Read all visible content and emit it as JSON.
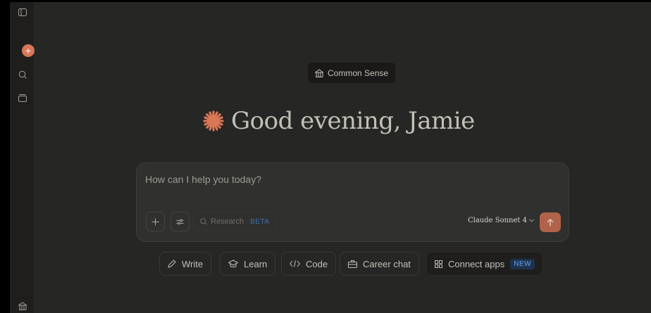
{
  "project": {
    "name": "Common Sense"
  },
  "greeting": "Good evening, Jamie",
  "composer": {
    "placeholder": "How can I help you today?",
    "research_label": "Research",
    "research_badge": "BETA",
    "model": "Claude Sonnet 4"
  },
  "chips": [
    {
      "label": "Write",
      "icon": "pen-icon"
    },
    {
      "label": "Learn",
      "icon": "graduation-cap-icon"
    },
    {
      "label": "Code",
      "icon": "code-icon"
    },
    {
      "label": "Career chat",
      "icon": "briefcase-icon"
    },
    {
      "label": "Connect apps",
      "icon": "apps-grid-icon",
      "badge": "NEW"
    }
  ],
  "colors": {
    "accent": "#d97757",
    "send_button": "#b0634a",
    "background": "#262624",
    "sidebar": "#1f1e1d",
    "composer": "#30302e",
    "new_badge": "#6aa3e8"
  }
}
